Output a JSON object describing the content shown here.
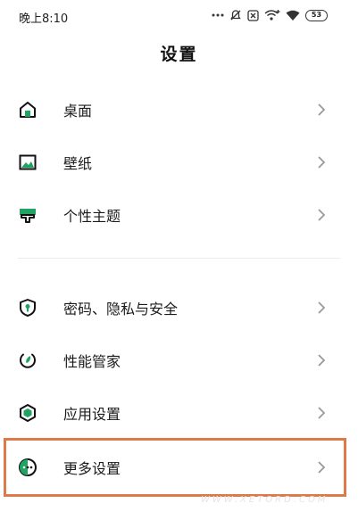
{
  "status_bar": {
    "time": "晚上8:10",
    "battery": "53",
    "icons": [
      "more-dots-icon",
      "mute-alarm-icon",
      "sim-off-icon",
      "wifi-calling-icon",
      "wifi-icon",
      "battery-icon"
    ]
  },
  "header": {
    "title": "设置"
  },
  "colors": {
    "accent": "#1fa463",
    "highlight": "#e0794a",
    "text": "#1b1b1b",
    "chevron": "#9a9a9a"
  },
  "settings": {
    "group1": [
      {
        "label": "桌面",
        "icon": "home-icon"
      },
      {
        "label": "壁纸",
        "icon": "wallpaper-icon"
      },
      {
        "label": "个性主题",
        "icon": "theme-icon"
      }
    ],
    "group2": [
      {
        "label": "密码、隐私与安全",
        "icon": "shield-icon"
      },
      {
        "label": "性能管家",
        "icon": "performance-icon"
      },
      {
        "label": "应用设置",
        "icon": "app-settings-icon"
      },
      {
        "label": "更多设置",
        "icon": "more-settings-icon"
      }
    ]
  },
  "watermark": "WWW.XETORD.COM"
}
